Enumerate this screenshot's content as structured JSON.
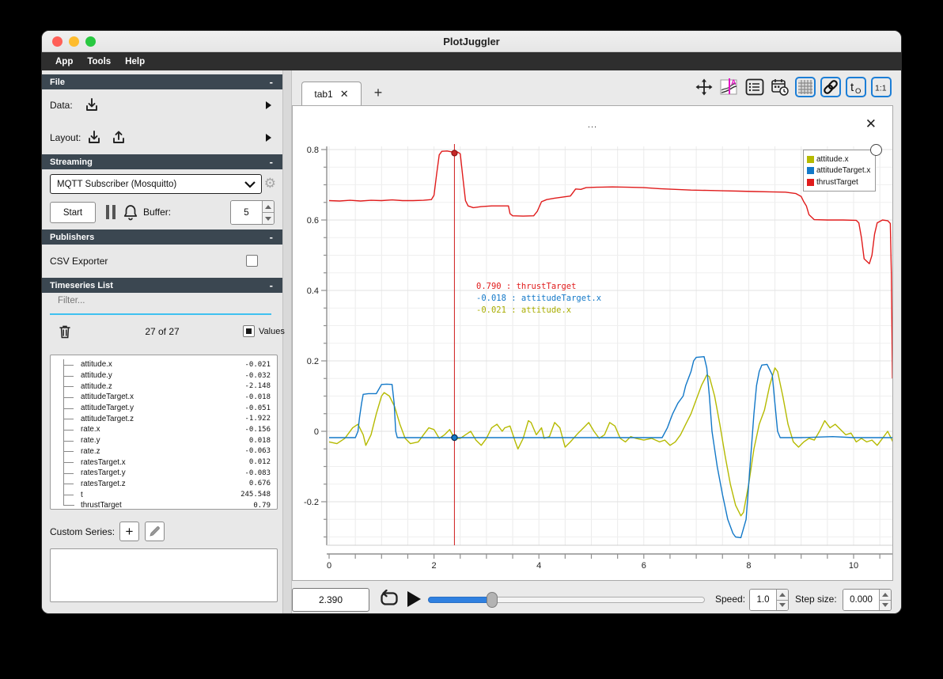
{
  "window": {
    "title": "PlotJuggler",
    "menu": [
      "App",
      "Tools",
      "Help"
    ]
  },
  "sidebar": {
    "file": {
      "header": "File",
      "data_label": "Data:",
      "layout_label": "Layout:"
    },
    "streaming": {
      "header": "Streaming",
      "source_selected": "MQTT Subscriber (Mosquitto)",
      "start_label": "Start",
      "buffer_label": "Buffer:",
      "buffer_value": "5"
    },
    "publishers": {
      "header": "Publishers",
      "csv_label": "CSV Exporter",
      "csv_checked": false
    },
    "timeseries": {
      "header": "Timeseries List",
      "filter_placeholder": "Filter...",
      "count": "27 of 27",
      "values_label": "Values",
      "items": [
        {
          "name": "attitude.x",
          "value": "-0.021"
        },
        {
          "name": "attitude.y",
          "value": "-0.032"
        },
        {
          "name": "attitude.z",
          "value": "-2.148"
        },
        {
          "name": "attitudeTarget.x",
          "value": "-0.018"
        },
        {
          "name": "attitudeTarget.y",
          "value": "-0.051"
        },
        {
          "name": "attitudeTarget.z",
          "value": "-1.922"
        },
        {
          "name": "rate.x",
          "value": "-0.156"
        },
        {
          "name": "rate.y",
          "value": "0.018"
        },
        {
          "name": "rate.z",
          "value": "-0.063"
        },
        {
          "name": "ratesTarget.x",
          "value": "0.012"
        },
        {
          "name": "ratesTarget.y",
          "value": "-0.083"
        },
        {
          "name": "ratesTarget.z",
          "value": "0.676"
        },
        {
          "name": "t",
          "value": "245.548"
        },
        {
          "name": "thrustTarget",
          "value": "0.79"
        }
      ],
      "custom_series_label": "Custom Series:"
    }
  },
  "main": {
    "tab": {
      "label": "tab1",
      "close": "✕",
      "add": "+"
    },
    "plot_close": "✕",
    "playback": {
      "time": "2.390",
      "speed_label": "Speed:",
      "speed_value": "1.0",
      "step_label": "Step size:",
      "step_value": "0.000"
    }
  },
  "chart_data": {
    "type": "line",
    "title": "...",
    "xlabel": "",
    "ylabel": "",
    "x_range": [
      0,
      10.77
    ],
    "y_range": [
      -0.323,
      0.809
    ],
    "x_ticks": [
      0,
      2,
      4,
      6,
      8,
      10
    ],
    "y_ticks": [
      -0.2,
      0,
      0.2,
      0.4,
      0.6,
      0.8
    ],
    "grid": true,
    "legend_position": "top-right",
    "tracker": {
      "time": 2.39,
      "dot_values": {
        "thrustTarget": 0.79,
        "attitudeTarget.x": -0.018
      }
    },
    "tooltip": [
      {
        "text": " 0.790 : thrustTarget",
        "color": "#e01b1b"
      },
      {
        "text": "-0.018 : attitudeTarget.x",
        "color": "#1278c8"
      },
      {
        "text": "-0.021 : attitude.x",
        "color": "#a9ad00"
      }
    ],
    "series": [
      {
        "name": "attitude.x",
        "color": "#b5ba00",
        "points": [
          [
            0,
            -0.03
          ],
          [
            0.15,
            -0.035
          ],
          [
            0.3,
            -0.02
          ],
          [
            0.45,
            0.01
          ],
          [
            0.55,
            0.02
          ],
          [
            0.65,
            -0.01
          ],
          [
            0.7,
            -0.04
          ],
          [
            0.8,
            -0.01
          ],
          [
            0.9,
            0.05
          ],
          [
            1.0,
            0.1
          ],
          [
            1.05,
            0.11
          ],
          [
            1.15,
            0.1
          ],
          [
            1.25,
            0.07
          ],
          [
            1.35,
            0.02
          ],
          [
            1.45,
            -0.02
          ],
          [
            1.55,
            -0.035
          ],
          [
            1.7,
            -0.03
          ],
          [
            1.8,
            -0.01
          ],
          [
            1.9,
            0.01
          ],
          [
            2.0,
            0.005
          ],
          [
            2.1,
            -0.02
          ],
          [
            2.2,
            -0.01
          ],
          [
            2.3,
            0.005
          ],
          [
            2.39,
            -0.021
          ],
          [
            2.5,
            -0.02
          ],
          [
            2.6,
            -0.01
          ],
          [
            2.7,
            0.0
          ],
          [
            2.8,
            -0.025
          ],
          [
            2.9,
            -0.04
          ],
          [
            3.0,
            -0.02
          ],
          [
            3.1,
            0.01
          ],
          [
            3.2,
            0.02
          ],
          [
            3.3,
            0.0
          ],
          [
            3.35,
            0.01
          ],
          [
            3.45,
            0.015
          ],
          [
            3.55,
            -0.03
          ],
          [
            3.6,
            -0.05
          ],
          [
            3.7,
            -0.02
          ],
          [
            3.8,
            0.03
          ],
          [
            3.85,
            0.025
          ],
          [
            3.95,
            -0.01
          ],
          [
            4.05,
            0.01
          ],
          [
            4.1,
            -0.02
          ],
          [
            4.2,
            -0.015
          ],
          [
            4.3,
            0.025
          ],
          [
            4.4,
            0.01
          ],
          [
            4.5,
            -0.045
          ],
          [
            4.6,
            -0.03
          ],
          [
            4.75,
            -0.005
          ],
          [
            4.85,
            0.01
          ],
          [
            4.95,
            0.025
          ],
          [
            5.05,
            0.0
          ],
          [
            5.15,
            -0.02
          ],
          [
            5.25,
            -0.01
          ],
          [
            5.35,
            0.025
          ],
          [
            5.45,
            0.015
          ],
          [
            5.55,
            -0.02
          ],
          [
            5.65,
            -0.03
          ],
          [
            5.75,
            -0.015
          ],
          [
            5.85,
            -0.02
          ],
          [
            6.0,
            -0.025
          ],
          [
            6.15,
            -0.02
          ],
          [
            6.3,
            -0.03
          ],
          [
            6.4,
            -0.025
          ],
          [
            6.5,
            -0.04
          ],
          [
            6.6,
            -0.03
          ],
          [
            6.7,
            -0.01
          ],
          [
            6.8,
            0.02
          ],
          [
            6.9,
            0.05
          ],
          [
            7.0,
            0.09
          ],
          [
            7.1,
            0.13
          ],
          [
            7.2,
            0.16
          ],
          [
            7.25,
            0.155
          ],
          [
            7.35,
            0.1
          ],
          [
            7.45,
            0.02
          ],
          [
            7.55,
            -0.07
          ],
          [
            7.65,
            -0.15
          ],
          [
            7.75,
            -0.21
          ],
          [
            7.85,
            -0.24
          ],
          [
            7.9,
            -0.23
          ],
          [
            8.0,
            -0.15
          ],
          [
            8.1,
            -0.05
          ],
          [
            8.2,
            0.02
          ],
          [
            8.3,
            0.06
          ],
          [
            8.4,
            0.13
          ],
          [
            8.5,
            0.18
          ],
          [
            8.55,
            0.17
          ],
          [
            8.65,
            0.1
          ],
          [
            8.75,
            0.02
          ],
          [
            8.85,
            -0.03
          ],
          [
            8.95,
            -0.045
          ],
          [
            9.05,
            -0.03
          ],
          [
            9.15,
            -0.02
          ],
          [
            9.25,
            -0.025
          ],
          [
            9.35,
            0.0
          ],
          [
            9.45,
            0.03
          ],
          [
            9.55,
            0.01
          ],
          [
            9.65,
            0.02
          ],
          [
            9.75,
            0.005
          ],
          [
            9.85,
            -0.01
          ],
          [
            9.95,
            -0.005
          ],
          [
            10.05,
            -0.03
          ],
          [
            10.15,
            -0.02
          ],
          [
            10.25,
            -0.03
          ],
          [
            10.35,
            -0.025
          ],
          [
            10.45,
            -0.04
          ],
          [
            10.55,
            -0.02
          ],
          [
            10.65,
            0.0
          ],
          [
            10.75,
            -0.03
          ]
        ]
      },
      {
        "name": "attitudeTarget.x",
        "color": "#1278c8",
        "points": [
          [
            0,
            -0.018
          ],
          [
            0.5,
            -0.018
          ],
          [
            0.55,
            0.0
          ],
          [
            0.58,
            0.04
          ],
          [
            0.62,
            0.08
          ],
          [
            0.65,
            0.105
          ],
          [
            0.75,
            0.107
          ],
          [
            0.9,
            0.107
          ],
          [
            0.95,
            0.12
          ],
          [
            1.0,
            0.133
          ],
          [
            1.1,
            0.134
          ],
          [
            1.2,
            0.133
          ],
          [
            1.24,
            0.08
          ],
          [
            1.27,
            0.0
          ],
          [
            1.3,
            -0.018
          ],
          [
            2.39,
            -0.018
          ],
          [
            4.0,
            -0.018
          ],
          [
            6.35,
            -0.018
          ],
          [
            6.45,
            0.01
          ],
          [
            6.5,
            0.03
          ],
          [
            6.55,
            0.05
          ],
          [
            6.65,
            0.08
          ],
          [
            6.75,
            0.1
          ],
          [
            6.8,
            0.13
          ],
          [
            6.9,
            0.17
          ],
          [
            6.95,
            0.2
          ],
          [
            7.0,
            0.21
          ],
          [
            7.15,
            0.212
          ],
          [
            7.2,
            0.18
          ],
          [
            7.25,
            0.1
          ],
          [
            7.3,
            0.0
          ],
          [
            7.35,
            -0.05
          ],
          [
            7.4,
            -0.1
          ],
          [
            7.5,
            -0.18
          ],
          [
            7.6,
            -0.25
          ],
          [
            7.7,
            -0.29
          ],
          [
            7.75,
            -0.3
          ],
          [
            7.85,
            -0.302
          ],
          [
            7.95,
            -0.25
          ],
          [
            8.0,
            -0.15
          ],
          [
            8.05,
            -0.05
          ],
          [
            8.1,
            0.05
          ],
          [
            8.15,
            0.13
          ],
          [
            8.2,
            0.17
          ],
          [
            8.25,
            0.188
          ],
          [
            8.35,
            0.19
          ],
          [
            8.45,
            0.16
          ],
          [
            8.5,
            0.08
          ],
          [
            8.55,
            0.0
          ],
          [
            8.6,
            -0.018
          ],
          [
            9.0,
            -0.018
          ],
          [
            9.6,
            -0.015
          ],
          [
            10.0,
            -0.018
          ],
          [
            10.76,
            -0.018
          ]
        ]
      },
      {
        "name": "thrustTarget",
        "color": "#e01b1b",
        "points": [
          [
            0,
            0.655
          ],
          [
            0.2,
            0.654
          ],
          [
            0.4,
            0.656
          ],
          [
            0.6,
            0.654
          ],
          [
            0.8,
            0.656
          ],
          [
            1.0,
            0.655
          ],
          [
            1.2,
            0.657
          ],
          [
            1.4,
            0.655
          ],
          [
            1.6,
            0.655
          ],
          [
            1.8,
            0.656
          ],
          [
            1.95,
            0.658
          ],
          [
            2.0,
            0.67
          ],
          [
            2.05,
            0.73
          ],
          [
            2.1,
            0.785
          ],
          [
            2.15,
            0.795
          ],
          [
            2.25,
            0.796
          ],
          [
            2.35,
            0.793
          ],
          [
            2.39,
            0.79
          ],
          [
            2.45,
            0.793
          ],
          [
            2.5,
            0.788
          ],
          [
            2.55,
            0.72
          ],
          [
            2.6,
            0.655
          ],
          [
            2.65,
            0.64
          ],
          [
            2.75,
            0.635
          ],
          [
            2.9,
            0.638
          ],
          [
            3.1,
            0.64
          ],
          [
            3.3,
            0.64
          ],
          [
            3.42,
            0.64
          ],
          [
            3.45,
            0.618
          ],
          [
            3.5,
            0.612
          ],
          [
            3.7,
            0.611
          ],
          [
            3.9,
            0.612
          ],
          [
            3.97,
            0.625
          ],
          [
            4.05,
            0.652
          ],
          [
            4.15,
            0.658
          ],
          [
            4.3,
            0.662
          ],
          [
            4.45,
            0.665
          ],
          [
            4.6,
            0.668
          ],
          [
            4.65,
            0.678
          ],
          [
            4.7,
            0.688
          ],
          [
            4.8,
            0.687
          ],
          [
            4.9,
            0.692
          ],
          [
            5.1,
            0.693
          ],
          [
            5.4,
            0.694
          ],
          [
            5.7,
            0.693
          ],
          [
            6.0,
            0.692
          ],
          [
            6.3,
            0.689
          ],
          [
            6.6,
            0.687
          ],
          [
            6.9,
            0.685
          ],
          [
            7.2,
            0.684
          ],
          [
            7.5,
            0.683
          ],
          [
            7.8,
            0.682
          ],
          [
            8.1,
            0.681
          ],
          [
            8.4,
            0.68
          ],
          [
            8.7,
            0.679
          ],
          [
            8.9,
            0.675
          ],
          [
            9.0,
            0.667
          ],
          [
            9.05,
            0.652
          ],
          [
            9.1,
            0.64
          ],
          [
            9.15,
            0.615
          ],
          [
            9.25,
            0.601
          ],
          [
            9.5,
            0.6
          ],
          [
            9.8,
            0.6
          ],
          [
            10.05,
            0.599
          ],
          [
            10.1,
            0.592
          ],
          [
            10.15,
            0.55
          ],
          [
            10.2,
            0.49
          ],
          [
            10.3,
            0.476
          ],
          [
            10.35,
            0.5
          ],
          [
            10.4,
            0.56
          ],
          [
            10.45,
            0.592
          ],
          [
            10.55,
            0.6
          ],
          [
            10.65,
            0.598
          ],
          [
            10.7,
            0.59
          ],
          [
            10.72,
            0.45
          ],
          [
            10.74,
            0.15
          ]
        ]
      }
    ]
  }
}
